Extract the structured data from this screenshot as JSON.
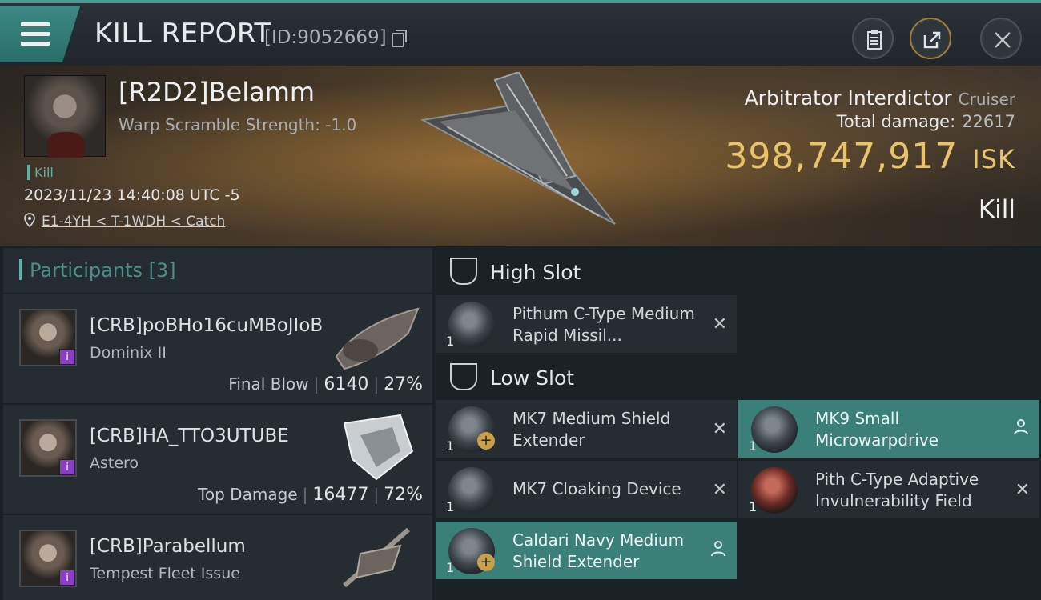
{
  "header": {
    "title": "KILL REPORT",
    "report_id": "[ID:9052669]"
  },
  "victim": {
    "name": "[R2D2]Belamm",
    "warp_scramble": "Warp Scramble Strength: -1.0",
    "tag": "Kill",
    "datetime": "2023/11/23 14:40:08 UTC -5",
    "location": "E1-4YH < T-1WDH < Catch"
  },
  "ship": {
    "name": "Arbitrator Interdictor",
    "class": "Cruiser",
    "total_damage_label": "Total damage:",
    "total_damage": "22617",
    "isk_value": "398,747,917",
    "isk_unit": "ISK",
    "result": "Kill"
  },
  "participants": {
    "label": "Participants",
    "count": "[3]",
    "rows": [
      {
        "name": "[CRB]poBHo16cuMBoJIoB",
        "ship": "Dominix II",
        "role": "Final Blow",
        "damage": "6140",
        "percent": "27%"
      },
      {
        "name": "[CRB]HA_TTO3UTUBE",
        "ship": "Astero",
        "role": "Top Damage",
        "damage": "16477",
        "percent": "72%"
      },
      {
        "name": "[CRB]Parabellum",
        "ship": "Tempest Fleet Issue",
        "role": "",
        "damage": "",
        "percent": ""
      }
    ]
  },
  "slots": {
    "high_title": "High Slot",
    "low_title": "Low Slot",
    "high": [
      {
        "name": "Pithum C-Type Medium Rapid Missil...",
        "qty": "1",
        "status": "destroyed"
      }
    ],
    "low": [
      {
        "name": "MK7 Medium Shield Extender",
        "qty": "1",
        "status": "destroyed"
      },
      {
        "name": "MK9 Small Microwarpdrive",
        "qty": "1",
        "status": "dropped"
      },
      {
        "name": "MK7 Cloaking Device",
        "qty": "1",
        "status": "destroyed"
      },
      {
        "name": "Pith C-Type Adaptive Invulnerability Field",
        "qty": "1",
        "status": "destroyed"
      },
      {
        "name": "Caldari Navy Medium Shield Extender",
        "qty": "1",
        "status": "dropped"
      }
    ]
  },
  "colors": {
    "accent": "#3b7f79",
    "isk": "#e9c36a",
    "badge": "#8a3fc1"
  },
  "icons": {
    "menu": "hamburger-icon",
    "copy": "copy-icon",
    "clipboard": "clipboard-icon",
    "share": "share-icon",
    "close": "close-icon",
    "location": "pin-icon",
    "slot": "slot-icon",
    "destroyed": "x-icon",
    "dropped": "person-icon"
  }
}
